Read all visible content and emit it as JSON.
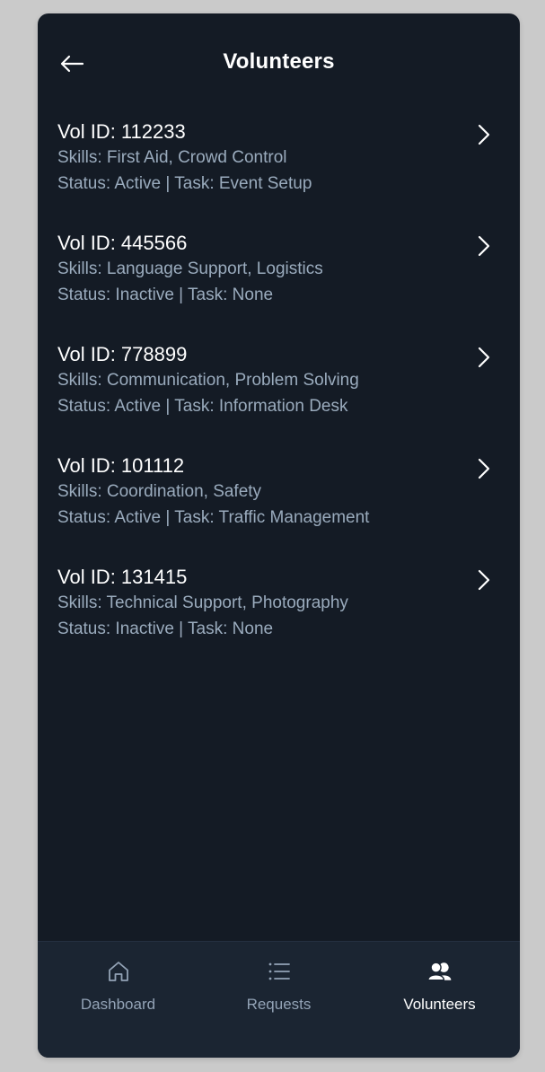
{
  "header": {
    "title": "Volunteers"
  },
  "volunteers": [
    {
      "id_label": "Vol ID: 112233",
      "skills": "Skills: First Aid, Crowd Control",
      "status": "Status: Active | Task: Event Setup"
    },
    {
      "id_label": "Vol ID: 445566",
      "skills": "Skills: Language Support, Logistics",
      "status": "Status: Inactive | Task: None"
    },
    {
      "id_label": "Vol ID: 778899",
      "skills": "Skills: Communication, Problem Solving",
      "status": "Status: Active | Task: Information Desk"
    },
    {
      "id_label": "Vol ID: 101112",
      "skills": "Skills: Coordination, Safety",
      "status": "Status: Active | Task: Traffic Management"
    },
    {
      "id_label": "Vol ID: 131415",
      "skills": "Skills: Technical Support, Photography",
      "status": "Status: Inactive | Task: None"
    }
  ],
  "bottom_nav": {
    "items": [
      {
        "label": "Dashboard",
        "icon": "home-icon",
        "active": false
      },
      {
        "label": "Requests",
        "icon": "list-icon",
        "active": false
      },
      {
        "label": "Volunteers",
        "icon": "users-icon",
        "active": true
      }
    ]
  },
  "colors": {
    "background": "#141b25",
    "nav_background": "#1b2532",
    "primary_text": "#ffffff",
    "secondary_text": "#9aabbd",
    "nav_inactive": "#93a3b6"
  }
}
